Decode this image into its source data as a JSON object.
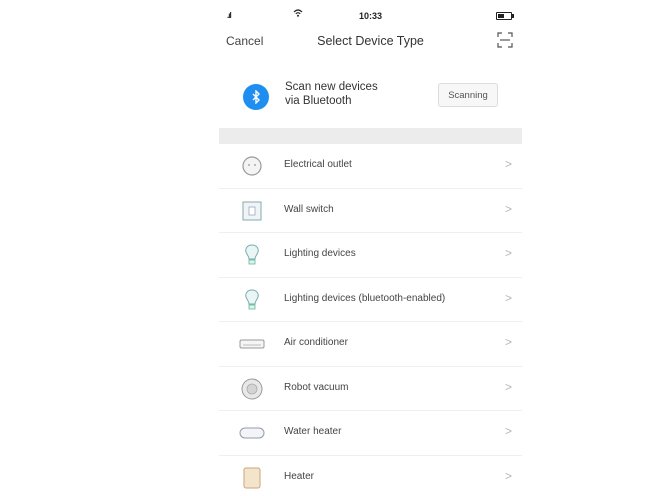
{
  "status_bar": {
    "time": "10:33"
  },
  "navbar": {
    "cancel_label": "Cancel",
    "title": "Select Device Type",
    "scan_icon": "scan-code-icon"
  },
  "bluetooth": {
    "line1": "Scan new devices",
    "line2": "via Bluetooth",
    "button_label": "Scanning",
    "icon": "bluetooth-icon",
    "accent": "#1e8ff1"
  },
  "devices": [
    {
      "label": "Electrical outlet",
      "icon": "outlet-icon"
    },
    {
      "label": "Wall switch",
      "icon": "wall-switch-icon"
    },
    {
      "label": "Lighting devices",
      "icon": "lightbulb-icon"
    },
    {
      "label": "Lighting devices (bluetooth-enabled)",
      "icon": "lightbulb-icon"
    },
    {
      "label": "Air conditioner",
      "icon": "air-conditioner-icon"
    },
    {
      "label": "Robot vacuum",
      "icon": "robot-vacuum-icon"
    },
    {
      "label": "Water heater",
      "icon": "water-heater-icon"
    },
    {
      "label": "Heater",
      "icon": "heater-icon"
    }
  ],
  "chevron": ">"
}
